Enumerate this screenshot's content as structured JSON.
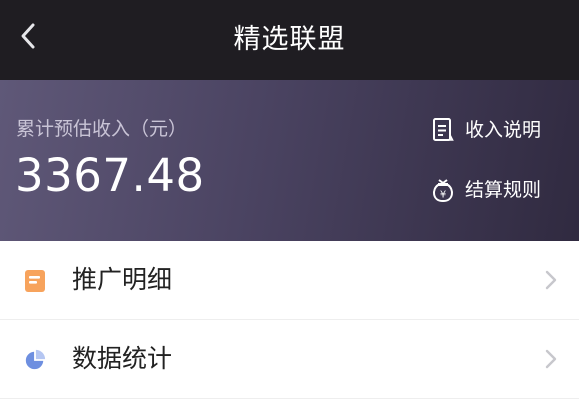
{
  "header": {
    "title": "精选联盟",
    "back_icon": "chevron-left-icon"
  },
  "earnings": {
    "label": "累计预估收入（元）",
    "amount": "3367.48",
    "links": [
      {
        "label": "收入说明",
        "icon": "document-icon"
      },
      {
        "label": "结算规则",
        "icon": "money-bag-icon"
      }
    ]
  },
  "menu": {
    "items": [
      {
        "label": "推广明细",
        "icon": "list-note-icon",
        "icon_color": "#f7a35c"
      },
      {
        "label": "数据统计",
        "icon": "pie-chart-icon",
        "icon_color": "#6e8fe0"
      }
    ]
  },
  "colors": {
    "navbar_bg": "#1f1d22",
    "banner_start": "#5f5878",
    "banner_end": "#302a40",
    "chevron": "#c7c7cc"
  }
}
